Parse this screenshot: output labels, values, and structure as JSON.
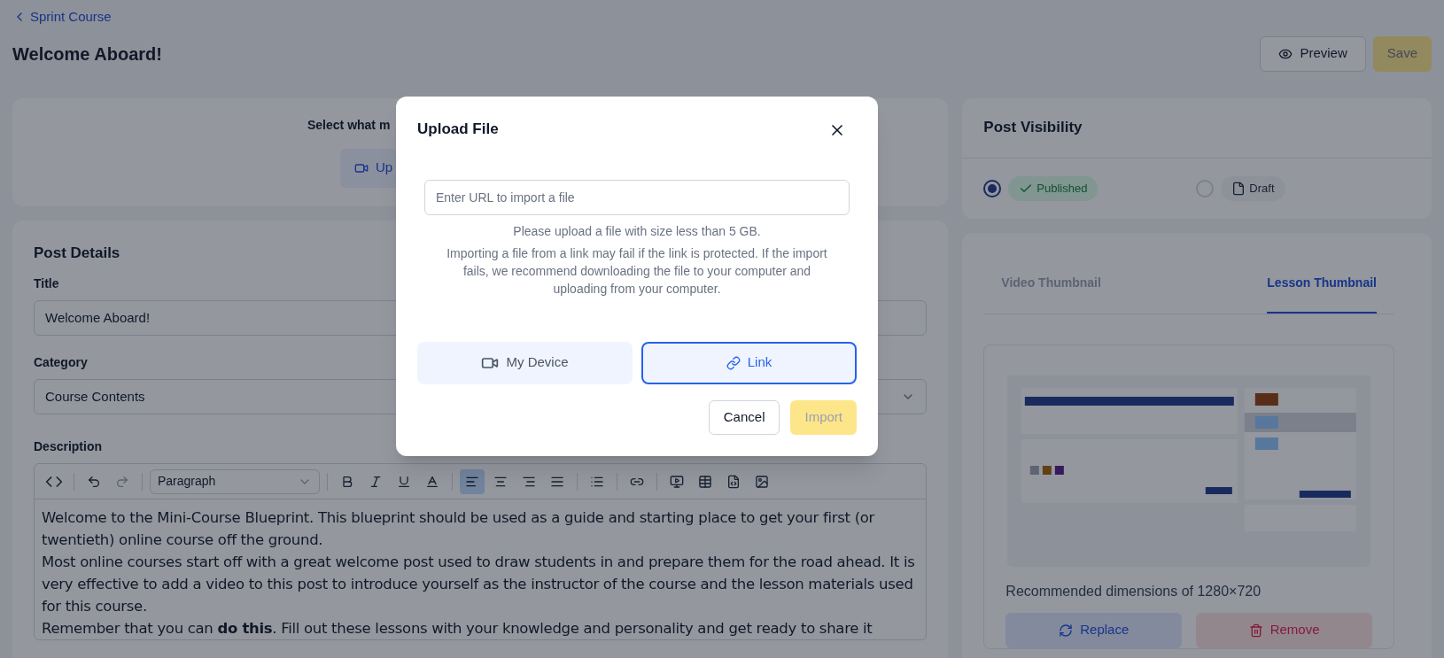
{
  "breadcrumb": "Sprint Course",
  "page_title": "Welcome Aboard!",
  "header_buttons": {
    "preview": "Preview",
    "save": "Save",
    "save_disabled": true
  },
  "upload_card": {
    "prompt": "Select what m",
    "button": "Up"
  },
  "post_details": {
    "title": "Post Details",
    "title_label": "Title",
    "title_value": "Welcome Aboard!",
    "category_label": "Category",
    "category_value": "Course Contents",
    "description_label": "Description",
    "toolbar": {
      "block_format": "Paragraph",
      "alignments": [
        {
          "selected": true
        },
        {
          "selected": false
        },
        {
          "selected": false
        },
        {
          "selected": false
        }
      ]
    },
    "body": [
      "Welcome to the Mini-Course Blueprint. This blueprint should be used as a guide and starting place to get your first (or twentieth) online course off the ground.",
      "Most online courses start off with a great welcome post used to draw students in and prepare them for the road ahead. It is very effective to add a video to this post to introduce yourself as the instructor of the course and the lesson materials used for this course.",
      "Remember that you can **do this**. Fill out these lessons with your knowledge and personality and get ready to share it"
    ]
  },
  "visibility": {
    "title": "Post Visibility",
    "options": [
      {
        "kind": "published",
        "label": "Published",
        "selected": true
      },
      {
        "kind": "draft",
        "label": "Draft",
        "selected": false
      }
    ]
  },
  "thumbnail": {
    "tabs": [
      {
        "label": "Video Thumbnail",
        "selected": false
      },
      {
        "label": "Lesson Thumbnail",
        "selected": true
      }
    ],
    "hint": "Recommended dimensions of 1280×720",
    "replace": "Replace",
    "remove": "Remove"
  },
  "modal": {
    "title": "Upload File",
    "url_placeholder": "Enter URL to import a file",
    "size_note": "Please upload a file with size less than 5 GB.",
    "link_note": "Importing a file from a link may fail if the link is protected. If the import fails, we recommend downloading the file to your computer and uploading from your computer.",
    "sources": [
      {
        "kind": "device",
        "label": "My Device",
        "selected": false
      },
      {
        "kind": "link",
        "label": "Link",
        "selected": true
      }
    ],
    "cancel": "Cancel",
    "import": "Import",
    "import_disabled": true
  }
}
